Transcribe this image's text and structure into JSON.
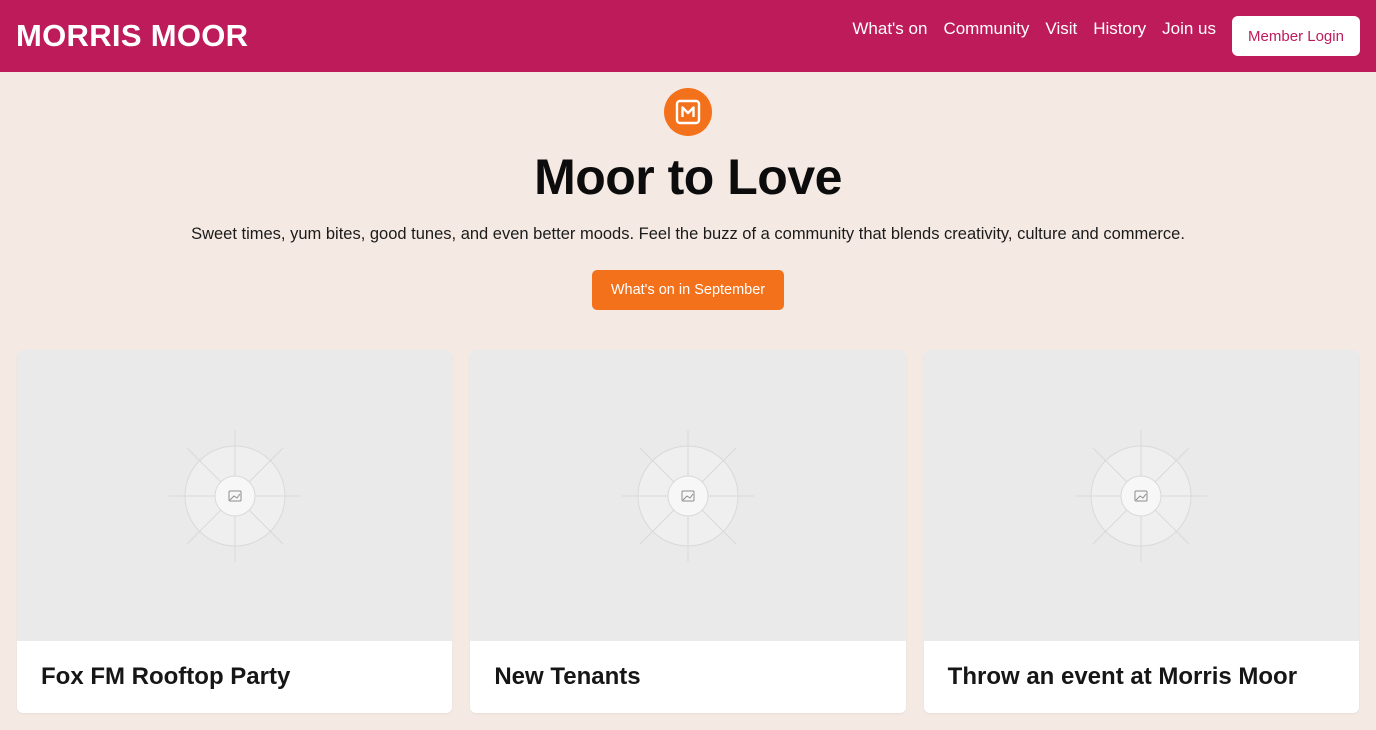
{
  "header": {
    "brand": "MORRIS MOOR",
    "nav": [
      {
        "label": "What's on"
      },
      {
        "label": "Community"
      },
      {
        "label": "Visit"
      },
      {
        "label": "History"
      },
      {
        "label": "Join us"
      }
    ],
    "login_label": "Member Login",
    "bar_color": "#be1b5a"
  },
  "hero": {
    "logo_icon": "m-badge-icon",
    "logo_color": "#f4711b",
    "title": "Moor to Love",
    "subtitle": "Sweet times, yum bites, good tunes, and even better moods. Feel the buzz of a community that blends creativity, culture and commerce.",
    "cta_label": "What's on in September"
  },
  "cards": [
    {
      "title": "Fox FM Rooftop Party",
      "image_icon": "image-placeholder-icon"
    },
    {
      "title": "New Tenants",
      "image_icon": "image-placeholder-icon"
    },
    {
      "title": "Throw an event at Morris Moor",
      "image_icon": "image-placeholder-icon"
    }
  ]
}
